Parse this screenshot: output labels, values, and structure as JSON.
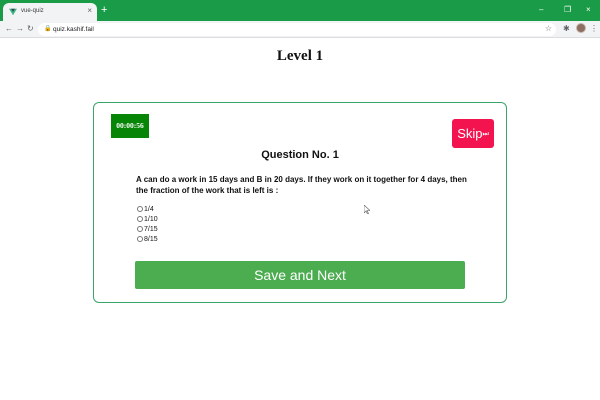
{
  "browser": {
    "tab_title": "vue-quiz",
    "tab_close": "×",
    "new_tab": "+",
    "url": "quiz.kashif.fail",
    "lock_icon": "🔒",
    "accent": "#1a9b48",
    "window_controls": {
      "minimize": "–",
      "restore": "❐",
      "close": "×"
    },
    "nav": {
      "back": "←",
      "forward": "→",
      "reload": "↻"
    },
    "toolbar_icons": {
      "bookmark": "☆",
      "extensions": "✱",
      "menu": "⋮"
    }
  },
  "page": {
    "level_title": "Level 1"
  },
  "quiz": {
    "timer": "00:00:56",
    "skip_label": "Skip",
    "skip_icon": "⏭",
    "question_no": "Question No. 1",
    "question_text": "A can do a work in 15 days and B in 20 days. If they work on it together for 4 days, then the fraction of the work that is left is :",
    "options": [
      "1/4",
      "1/10",
      "7/15",
      "8/15"
    ],
    "save_label": "Save and Next",
    "colors": {
      "timer": "#078507",
      "skip": "#f2134f",
      "save": "#4cad50",
      "border": "#3aa56b"
    }
  }
}
